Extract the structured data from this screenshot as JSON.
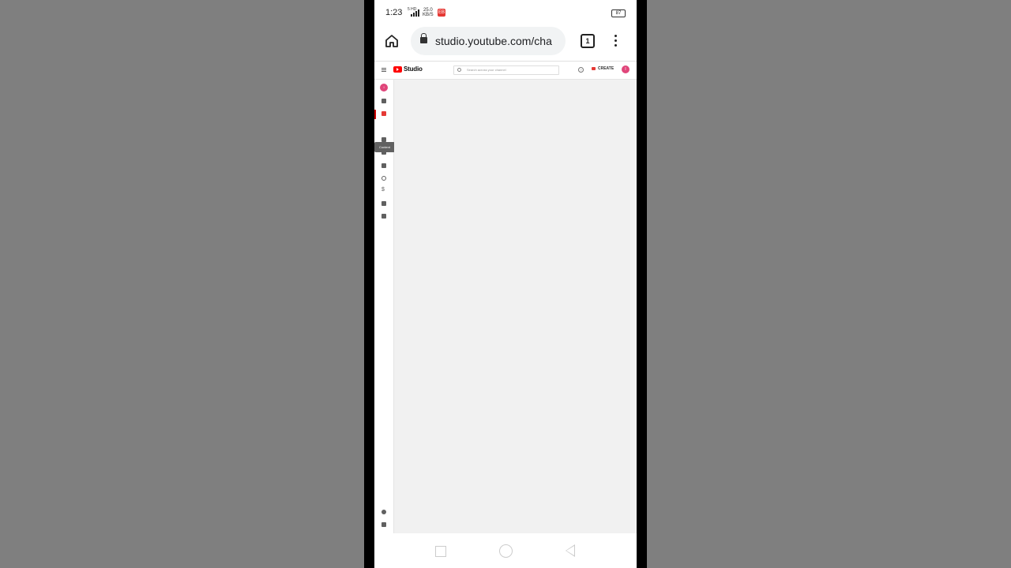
{
  "status_bar": {
    "time": "1:23",
    "signal_label": "5 HD",
    "network_speed": "25.0\nKB/S",
    "notification_badge": "EB",
    "battery": "87"
  },
  "browser": {
    "url": "studio.youtube.com/cha",
    "tab_count": "1"
  },
  "studio": {
    "wordmark": "Studio",
    "search_placeholder": "Search across your channel",
    "create_label": "CREATE",
    "account_initial": "I",
    "channel_initial": "I",
    "tooltip": "Content",
    "sidebar_items": [
      {
        "name": "dashboard"
      },
      {
        "name": "content",
        "active": true
      },
      {
        "name": "playlists"
      },
      {
        "name": "analytics"
      },
      {
        "name": "comments"
      },
      {
        "name": "subtitles"
      },
      {
        "name": "copyright"
      },
      {
        "name": "earn"
      },
      {
        "name": "customisation"
      },
      {
        "name": "audio-library"
      }
    ]
  },
  "colors": {
    "accent": "#e53935",
    "avatar": "#e0457a",
    "main_background": "#f1f1f1"
  }
}
